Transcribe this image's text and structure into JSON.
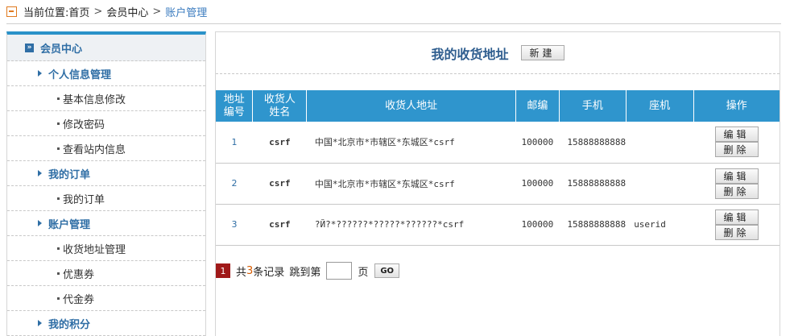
{
  "breadcrumb": {
    "prefix": "当前位置:",
    "home": "首页",
    "sep": ">",
    "center": "会员中心",
    "current": "账户管理"
  },
  "sidebar": {
    "head": "会员中心",
    "groups": [
      {
        "label": "个人信息管理",
        "items": [
          "基本信息修改",
          "修改密码",
          "查看站内信息"
        ]
      },
      {
        "label": "我的订单",
        "items": [
          "我的订单"
        ]
      },
      {
        "label": "账户管理",
        "items": [
          "收货地址管理",
          "优惠券",
          "代金券"
        ]
      },
      {
        "label": "我的积分",
        "items": []
      }
    ]
  },
  "main": {
    "title": "我的收货地址",
    "new_button": "新建",
    "columns": [
      "地址\n编号",
      "收货人\n姓名",
      "收货人地址",
      "邮编",
      "手机",
      "座机",
      "操作"
    ],
    "rows": [
      {
        "id": "1",
        "name": "csrf",
        "address": "中国*北京市*市辖区*东城区*csrf",
        "zip": "100000",
        "mobile": "15888888888",
        "tel": ""
      },
      {
        "id": "2",
        "name": "csrf",
        "address": "中国*北京市*市辖区*东城区*csrf",
        "zip": "100000",
        "mobile": "15888888888",
        "tel": ""
      },
      {
        "id": "3",
        "name": "csrf",
        "address": "?Й?*??????*?????*??????*csrf",
        "zip": "100000",
        "mobile": "15888888888",
        "tel": "userid"
      }
    ],
    "edit_label": "编辑",
    "delete_label": "删除"
  },
  "pager": {
    "current_page": "1",
    "total_prefix": "共",
    "total_count": "3",
    "total_suffix": "条记录",
    "jump_label": "跳到第",
    "page_unit": "页",
    "go_label": "GO",
    "input_value": ""
  }
}
